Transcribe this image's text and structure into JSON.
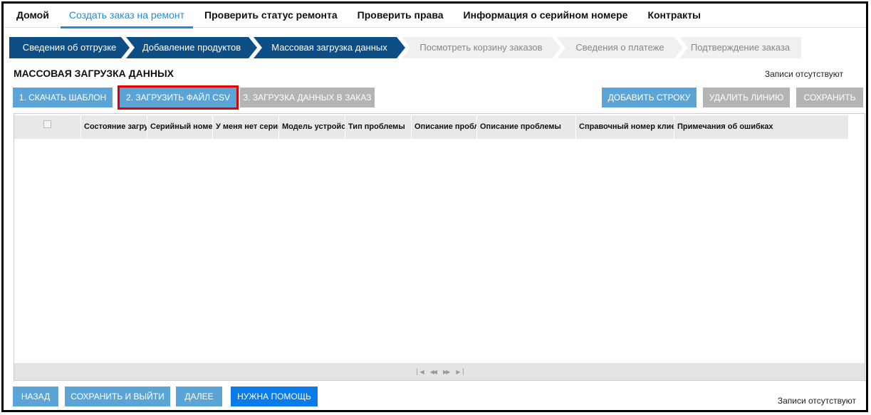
{
  "nav": {
    "items": [
      {
        "label": "Домой",
        "active": false
      },
      {
        "label": "Создать заказ на ремонт",
        "active": true
      },
      {
        "label": "Проверить статус ремонта",
        "active": false
      },
      {
        "label": "Проверить права",
        "active": false
      },
      {
        "label": "Информация о серийном номере",
        "active": false
      },
      {
        "label": "Контракты",
        "active": false
      }
    ]
  },
  "steps": [
    {
      "label": "Сведения об отгрузке",
      "state": "done"
    },
    {
      "label": "Добавление продуктов",
      "state": "done"
    },
    {
      "label": "Массовая загрузка данных",
      "state": "done"
    },
    {
      "label": "Посмотреть корзину заказов",
      "state": "todo"
    },
    {
      "label": "Сведения о платеже",
      "state": "todo"
    },
    {
      "label": "Подтверждение заказа",
      "state": "todo"
    }
  ],
  "page": {
    "title": "МАССОВАЯ ЗАГРУЗКА ДАННЫХ",
    "records_top": "Записи отсутствуют",
    "records_bottom": "Записи отсутствуют"
  },
  "toolbar": {
    "download_template": "1. СКАЧАТЬ ШАБЛОН",
    "upload_csv": "2. ЗАГРУЗИТЬ ФАЙЛ CSV",
    "load_to_order": "3. ЗАГРУЗКА ДАННЫХ В ЗАКАЗ",
    "add_row": "ДОБАВИТЬ СТРОКУ",
    "delete_line": "УДАЛИТЬ ЛИНИЮ",
    "save": "СОХРАНИТЬ"
  },
  "table": {
    "columns": [
      "Состояние загрузки",
      "Серийный номер",
      "У меня нет серийного номера",
      "Модель устройства",
      "Тип проблемы",
      "Описание проблемы",
      "Описание проблемы",
      "Справочный номер клиента",
      "Примечания об ошибках"
    ],
    "pager_icons": [
      "first-page-icon",
      "prev-page-icon",
      "next-page-icon",
      "last-page-icon"
    ]
  },
  "footer": {
    "back": "НАЗАД",
    "save_exit": "СОХРАНИТЬ И ВЫЙТИ",
    "next": "ДАЛЕЕ",
    "help": "НУЖНА ПОМОЩЬ"
  },
  "colors": {
    "accent": "#1b8fd8",
    "step_done": "#0d4e86",
    "button_blue": "#5ba5d6",
    "button_grey": "#b4b4b4",
    "button_help": "#0a7be8",
    "highlight": "#e00000"
  }
}
